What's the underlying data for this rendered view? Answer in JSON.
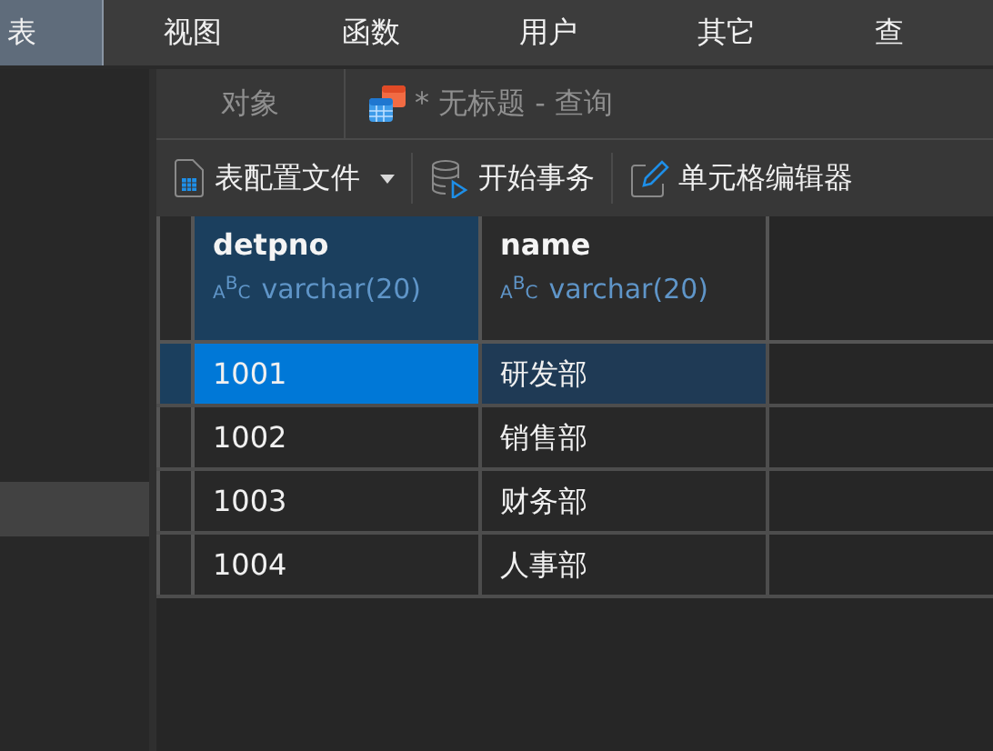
{
  "menu": [
    {
      "label": "表",
      "selected": true
    },
    {
      "label": "视图",
      "selected": false
    },
    {
      "label": "函数",
      "selected": false
    },
    {
      "label": "用户",
      "selected": false
    },
    {
      "label": "其它",
      "selected": false
    },
    {
      "label": "查",
      "selected": false
    }
  ],
  "tabs": [
    {
      "label": "对象",
      "kind": "plain"
    },
    {
      "label": "* 无标题 - 查询",
      "kind": "query"
    }
  ],
  "toolbar": [
    {
      "label": "表配置文件",
      "kind": "profile",
      "dropdown": true
    },
    {
      "label": "开始事务",
      "kind": "transaction",
      "dropdown": false
    },
    {
      "label": "单元格编辑器",
      "kind": "editor",
      "dropdown": false
    }
  ],
  "table": {
    "columns": [
      {
        "name": "detpno",
        "type_icon": "ABC",
        "type": "varchar(20)",
        "selected": true
      },
      {
        "name": "name",
        "type_icon": "ABC",
        "type": "varchar(20)",
        "selected": false
      }
    ],
    "rows": [
      {
        "cells": [
          "1001",
          "研发部"
        ],
        "selected": true
      },
      {
        "cells": [
          "1002",
          "销售部"
        ],
        "selected": false
      },
      {
        "cells": [
          "1003",
          "财务部"
        ],
        "selected": false
      },
      {
        "cells": [
          "1004",
          "人事部"
        ],
        "selected": false
      }
    ]
  }
}
